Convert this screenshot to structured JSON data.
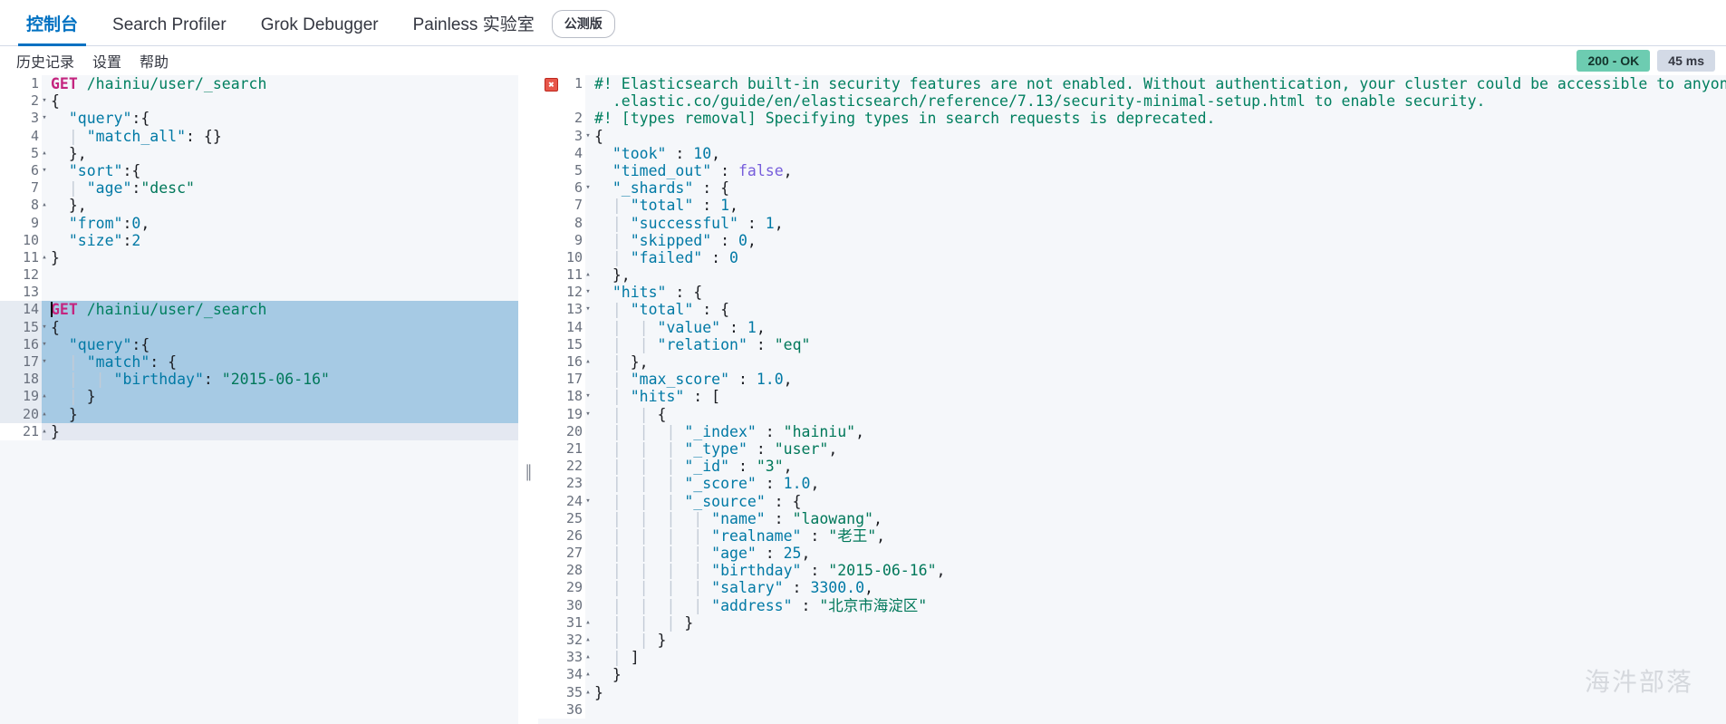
{
  "tabs": [
    {
      "label": "控制台",
      "active": true
    },
    {
      "label": "Search Profiler",
      "active": false
    },
    {
      "label": "Grok Debugger",
      "active": false
    },
    {
      "label": "Painless 实验室",
      "active": false
    }
  ],
  "beta_badge": "公测版",
  "menu": [
    {
      "label": "历史记录"
    },
    {
      "label": "设置"
    },
    {
      "label": "帮助"
    }
  ],
  "status": {
    "code": "200 - OK",
    "time": "45 ms",
    "ok_color": "#6dccb1",
    "time_color": "#d3dae6"
  },
  "icons": {
    "play": "play-icon",
    "wrench": "wrench-icon",
    "error_marker": "error-marker-icon",
    "splitter": "panel-splitter-handle"
  },
  "editor": {
    "lines": [
      {
        "n": "1",
        "fold": "",
        "segs": [
          {
            "c": "t-method",
            "t": "GET"
          },
          {
            "c": "t-url",
            "t": " /hainiu/user/_search"
          }
        ]
      },
      {
        "n": "2",
        "fold": "▾",
        "segs": [
          {
            "c": "t-punc",
            "t": "{"
          }
        ]
      },
      {
        "n": "3",
        "fold": "▾",
        "segs": [
          {
            "c": "t-punc",
            "t": "  "
          },
          {
            "c": "t-key",
            "t": "\"query\""
          },
          {
            "c": "t-punc",
            "t": ":{"
          }
        ]
      },
      {
        "n": "4",
        "fold": "",
        "segs": [
          {
            "c": "t-guide",
            "t": "  | "
          },
          {
            "c": "t-key",
            "t": "\"match_all\""
          },
          {
            "c": "t-punc",
            "t": ": {}"
          }
        ]
      },
      {
        "n": "5",
        "fold": "▴",
        "segs": [
          {
            "c": "t-punc",
            "t": "  },"
          }
        ]
      },
      {
        "n": "6",
        "fold": "▾",
        "segs": [
          {
            "c": "t-punc",
            "t": "  "
          },
          {
            "c": "t-key",
            "t": "\"sort\""
          },
          {
            "c": "t-punc",
            "t": ":{"
          }
        ]
      },
      {
        "n": "7",
        "fold": "",
        "segs": [
          {
            "c": "t-guide",
            "t": "  | "
          },
          {
            "c": "t-key",
            "t": "\"age\""
          },
          {
            "c": "t-punc",
            "t": ":"
          },
          {
            "c": "t-str",
            "t": "\"desc\""
          }
        ]
      },
      {
        "n": "8",
        "fold": "▴",
        "segs": [
          {
            "c": "t-punc",
            "t": "  },"
          }
        ]
      },
      {
        "n": "9",
        "fold": "",
        "segs": [
          {
            "c": "t-punc",
            "t": "  "
          },
          {
            "c": "t-key",
            "t": "\"from\""
          },
          {
            "c": "t-punc",
            "t": ":"
          },
          {
            "c": "t-num",
            "t": "0"
          },
          {
            "c": "t-punc",
            "t": ","
          }
        ]
      },
      {
        "n": "10",
        "fold": "",
        "segs": [
          {
            "c": "t-punc",
            "t": "  "
          },
          {
            "c": "t-key",
            "t": "\"size\""
          },
          {
            "c": "t-punc",
            "t": ":"
          },
          {
            "c": "t-num",
            "t": "2"
          }
        ]
      },
      {
        "n": "11",
        "fold": "▴",
        "segs": [
          {
            "c": "t-punc",
            "t": "}"
          }
        ]
      },
      {
        "n": "12",
        "fold": "",
        "segs": []
      },
      {
        "n": "13",
        "fold": "",
        "segs": []
      },
      {
        "n": "14",
        "fold": "",
        "sel": true,
        "caret": true,
        "actions": true,
        "segs": [
          {
            "c": "t-method",
            "t": "GET"
          },
          {
            "c": "t-url",
            "t": " /hainiu/user/_search"
          }
        ]
      },
      {
        "n": "15",
        "fold": "▾",
        "sel": true,
        "segs": [
          {
            "c": "t-punc",
            "t": "{"
          }
        ]
      },
      {
        "n": "16",
        "fold": "▾",
        "sel": true,
        "segs": [
          {
            "c": "t-punc",
            "t": "  "
          },
          {
            "c": "t-key",
            "t": "\"query\""
          },
          {
            "c": "t-punc",
            "t": ":{"
          }
        ]
      },
      {
        "n": "17",
        "fold": "▾",
        "sel": true,
        "segs": [
          {
            "c": "t-guide",
            "t": "  | "
          },
          {
            "c": "t-key",
            "t": "\"match\""
          },
          {
            "c": "t-punc",
            "t": ": {"
          }
        ]
      },
      {
        "n": "18",
        "fold": "",
        "sel": true,
        "segs": [
          {
            "c": "t-guide",
            "t": "  |  | "
          },
          {
            "c": "t-key",
            "t": "\"birthday\""
          },
          {
            "c": "t-punc",
            "t": ": "
          },
          {
            "c": "t-str",
            "t": "\"2015-06-16\""
          }
        ]
      },
      {
        "n": "19",
        "fold": "▴",
        "sel": true,
        "segs": [
          {
            "c": "t-guide",
            "t": "  | "
          },
          {
            "c": "t-punc",
            "t": "}"
          }
        ]
      },
      {
        "n": "20",
        "fold": "▴",
        "sel": true,
        "segs": [
          {
            "c": "t-punc",
            "t": "  }"
          }
        ]
      },
      {
        "n": "21",
        "fold": "▴",
        "cursorline": true,
        "segs": [
          {
            "c": "t-punc",
            "t": "}"
          }
        ]
      }
    ]
  },
  "output": {
    "lines": [
      {
        "n": "1",
        "fold": "",
        "marker": true,
        "segs": [
          {
            "c": "t-warn",
            "t": "#! Elasticsearch built-in security features are not enabled. Without authentication, your cluster could be accessible to anyone. See https://www"
          }
        ]
      },
      {
        "n": "",
        "fold": "",
        "segs": [
          {
            "c": "t-warn",
            "t": "  .elastic.co/guide/en/elasticsearch/reference/7.13/security-minimal-setup.html to enable security."
          }
        ]
      },
      {
        "n": "2",
        "fold": "",
        "segs": [
          {
            "c": "t-warn",
            "t": "#! [types removal] Specifying types in search requests is deprecated."
          }
        ]
      },
      {
        "n": "3",
        "fold": "▾",
        "segs": [
          {
            "c": "t-punc",
            "t": "{"
          }
        ]
      },
      {
        "n": "4",
        "fold": "",
        "segs": [
          {
            "c": "t-punc",
            "t": "  "
          },
          {
            "c": "t-key",
            "t": "\"took\""
          },
          {
            "c": "t-punc",
            "t": " : "
          },
          {
            "c": "t-num",
            "t": "10"
          },
          {
            "c": "t-punc",
            "t": ","
          }
        ]
      },
      {
        "n": "5",
        "fold": "",
        "segs": [
          {
            "c": "t-punc",
            "t": "  "
          },
          {
            "c": "t-key",
            "t": "\"timed_out\""
          },
          {
            "c": "t-punc",
            "t": " : "
          },
          {
            "c": "t-bool",
            "t": "false"
          },
          {
            "c": "t-punc",
            "t": ","
          }
        ]
      },
      {
        "n": "6",
        "fold": "▾",
        "segs": [
          {
            "c": "t-punc",
            "t": "  "
          },
          {
            "c": "t-key",
            "t": "\"_shards\""
          },
          {
            "c": "t-punc",
            "t": " : {"
          }
        ]
      },
      {
        "n": "7",
        "fold": "",
        "segs": [
          {
            "c": "t-guide",
            "t": "  | "
          },
          {
            "c": "t-key",
            "t": "\"total\""
          },
          {
            "c": "t-punc",
            "t": " : "
          },
          {
            "c": "t-num",
            "t": "1"
          },
          {
            "c": "t-punc",
            "t": ","
          }
        ]
      },
      {
        "n": "8",
        "fold": "",
        "segs": [
          {
            "c": "t-guide",
            "t": "  | "
          },
          {
            "c": "t-key",
            "t": "\"successful\""
          },
          {
            "c": "t-punc",
            "t": " : "
          },
          {
            "c": "t-num",
            "t": "1"
          },
          {
            "c": "t-punc",
            "t": ","
          }
        ]
      },
      {
        "n": "9",
        "fold": "",
        "segs": [
          {
            "c": "t-guide",
            "t": "  | "
          },
          {
            "c": "t-key",
            "t": "\"skipped\""
          },
          {
            "c": "t-punc",
            "t": " : "
          },
          {
            "c": "t-num",
            "t": "0"
          },
          {
            "c": "t-punc",
            "t": ","
          }
        ]
      },
      {
        "n": "10",
        "fold": "",
        "segs": [
          {
            "c": "t-guide",
            "t": "  | "
          },
          {
            "c": "t-key",
            "t": "\"failed\""
          },
          {
            "c": "t-punc",
            "t": " : "
          },
          {
            "c": "t-num",
            "t": "0"
          }
        ]
      },
      {
        "n": "11",
        "fold": "▴",
        "segs": [
          {
            "c": "t-punc",
            "t": "  },"
          }
        ]
      },
      {
        "n": "12",
        "fold": "▾",
        "segs": [
          {
            "c": "t-punc",
            "t": "  "
          },
          {
            "c": "t-key",
            "t": "\"hits\""
          },
          {
            "c": "t-punc",
            "t": " : {"
          }
        ]
      },
      {
        "n": "13",
        "fold": "▾",
        "segs": [
          {
            "c": "t-guide",
            "t": "  | "
          },
          {
            "c": "t-key",
            "t": "\"total\""
          },
          {
            "c": "t-punc",
            "t": " : {"
          }
        ]
      },
      {
        "n": "14",
        "fold": "",
        "segs": [
          {
            "c": "t-guide",
            "t": "  |  | "
          },
          {
            "c": "t-key",
            "t": "\"value\""
          },
          {
            "c": "t-punc",
            "t": " : "
          },
          {
            "c": "t-num",
            "t": "1"
          },
          {
            "c": "t-punc",
            "t": ","
          }
        ]
      },
      {
        "n": "15",
        "fold": "",
        "segs": [
          {
            "c": "t-guide",
            "t": "  |  | "
          },
          {
            "c": "t-key",
            "t": "\"relation\""
          },
          {
            "c": "t-punc",
            "t": " : "
          },
          {
            "c": "t-str",
            "t": "\"eq\""
          }
        ]
      },
      {
        "n": "16",
        "fold": "▴",
        "segs": [
          {
            "c": "t-guide",
            "t": "  | "
          },
          {
            "c": "t-punc",
            "t": "},"
          }
        ]
      },
      {
        "n": "17",
        "fold": "",
        "segs": [
          {
            "c": "t-guide",
            "t": "  | "
          },
          {
            "c": "t-key",
            "t": "\"max_score\""
          },
          {
            "c": "t-punc",
            "t": " : "
          },
          {
            "c": "t-num",
            "t": "1.0"
          },
          {
            "c": "t-punc",
            "t": ","
          }
        ]
      },
      {
        "n": "18",
        "fold": "▾",
        "segs": [
          {
            "c": "t-guide",
            "t": "  | "
          },
          {
            "c": "t-key",
            "t": "\"hits\""
          },
          {
            "c": "t-punc",
            "t": " : ["
          }
        ]
      },
      {
        "n": "19",
        "fold": "▾",
        "segs": [
          {
            "c": "t-guide",
            "t": "  |  | "
          },
          {
            "c": "t-punc",
            "t": "{"
          }
        ]
      },
      {
        "n": "20",
        "fold": "",
        "segs": [
          {
            "c": "t-guide",
            "t": "  |  |  | "
          },
          {
            "c": "t-key",
            "t": "\"_index\""
          },
          {
            "c": "t-punc",
            "t": " : "
          },
          {
            "c": "t-str",
            "t": "\"hainiu\""
          },
          {
            "c": "t-punc",
            "t": ","
          }
        ]
      },
      {
        "n": "21",
        "fold": "",
        "segs": [
          {
            "c": "t-guide",
            "t": "  |  |  | "
          },
          {
            "c": "t-key",
            "t": "\"_type\""
          },
          {
            "c": "t-punc",
            "t": " : "
          },
          {
            "c": "t-str",
            "t": "\"user\""
          },
          {
            "c": "t-punc",
            "t": ","
          }
        ]
      },
      {
        "n": "22",
        "fold": "",
        "segs": [
          {
            "c": "t-guide",
            "t": "  |  |  | "
          },
          {
            "c": "t-key",
            "t": "\"_id\""
          },
          {
            "c": "t-punc",
            "t": " : "
          },
          {
            "c": "t-str",
            "t": "\"3\""
          },
          {
            "c": "t-punc",
            "t": ","
          }
        ]
      },
      {
        "n": "23",
        "fold": "",
        "segs": [
          {
            "c": "t-guide",
            "t": "  |  |  | "
          },
          {
            "c": "t-key",
            "t": "\"_score\""
          },
          {
            "c": "t-punc",
            "t": " : "
          },
          {
            "c": "t-num",
            "t": "1.0"
          },
          {
            "c": "t-punc",
            "t": ","
          }
        ]
      },
      {
        "n": "24",
        "fold": "▾",
        "segs": [
          {
            "c": "t-guide",
            "t": "  |  |  | "
          },
          {
            "c": "t-key",
            "t": "\"_source\""
          },
          {
            "c": "t-punc",
            "t": " : {"
          }
        ]
      },
      {
        "n": "25",
        "fold": "",
        "segs": [
          {
            "c": "t-guide",
            "t": "  |  |  |  | "
          },
          {
            "c": "t-key",
            "t": "\"name\""
          },
          {
            "c": "t-punc",
            "t": " : "
          },
          {
            "c": "t-str",
            "t": "\"laowang\""
          },
          {
            "c": "t-punc",
            "t": ","
          }
        ]
      },
      {
        "n": "26",
        "fold": "",
        "segs": [
          {
            "c": "t-guide",
            "t": "  |  |  |  | "
          },
          {
            "c": "t-key",
            "t": "\"realname\""
          },
          {
            "c": "t-punc",
            "t": " : "
          },
          {
            "c": "t-str",
            "t": "\"老王\""
          },
          {
            "c": "t-punc",
            "t": ","
          }
        ]
      },
      {
        "n": "27",
        "fold": "",
        "segs": [
          {
            "c": "t-guide",
            "t": "  |  |  |  | "
          },
          {
            "c": "t-key",
            "t": "\"age\""
          },
          {
            "c": "t-punc",
            "t": " : "
          },
          {
            "c": "t-num",
            "t": "25"
          },
          {
            "c": "t-punc",
            "t": ","
          }
        ]
      },
      {
        "n": "28",
        "fold": "",
        "segs": [
          {
            "c": "t-guide",
            "t": "  |  |  |  | "
          },
          {
            "c": "t-key",
            "t": "\"birthday\""
          },
          {
            "c": "t-punc",
            "t": " : "
          },
          {
            "c": "t-str",
            "t": "\"2015-06-16\""
          },
          {
            "c": "t-punc",
            "t": ","
          }
        ]
      },
      {
        "n": "29",
        "fold": "",
        "segs": [
          {
            "c": "t-guide",
            "t": "  |  |  |  | "
          },
          {
            "c": "t-key",
            "t": "\"salary\""
          },
          {
            "c": "t-punc",
            "t": " : "
          },
          {
            "c": "t-num",
            "t": "3300.0"
          },
          {
            "c": "t-punc",
            "t": ","
          }
        ]
      },
      {
        "n": "30",
        "fold": "",
        "segs": [
          {
            "c": "t-guide",
            "t": "  |  |  |  | "
          },
          {
            "c": "t-key",
            "t": "\"address\""
          },
          {
            "c": "t-punc",
            "t": " : "
          },
          {
            "c": "t-str",
            "t": "\"北京市海淀区\""
          }
        ]
      },
      {
        "n": "31",
        "fold": "▴",
        "segs": [
          {
            "c": "t-guide",
            "t": "  |  |  | "
          },
          {
            "c": "t-punc",
            "t": "}"
          }
        ]
      },
      {
        "n": "32",
        "fold": "▴",
        "segs": [
          {
            "c": "t-guide",
            "t": "  |  | "
          },
          {
            "c": "t-punc",
            "t": "}"
          }
        ]
      },
      {
        "n": "33",
        "fold": "▴",
        "segs": [
          {
            "c": "t-guide",
            "t": "  | "
          },
          {
            "c": "t-punc",
            "t": "]"
          }
        ]
      },
      {
        "n": "34",
        "fold": "▴",
        "segs": [
          {
            "c": "t-punc",
            "t": "  }"
          }
        ]
      },
      {
        "n": "35",
        "fold": "▴",
        "segs": [
          {
            "c": "t-punc",
            "t": "}"
          }
        ]
      },
      {
        "n": "36",
        "fold": "",
        "segs": []
      }
    ]
  },
  "watermark": "海汼部落"
}
